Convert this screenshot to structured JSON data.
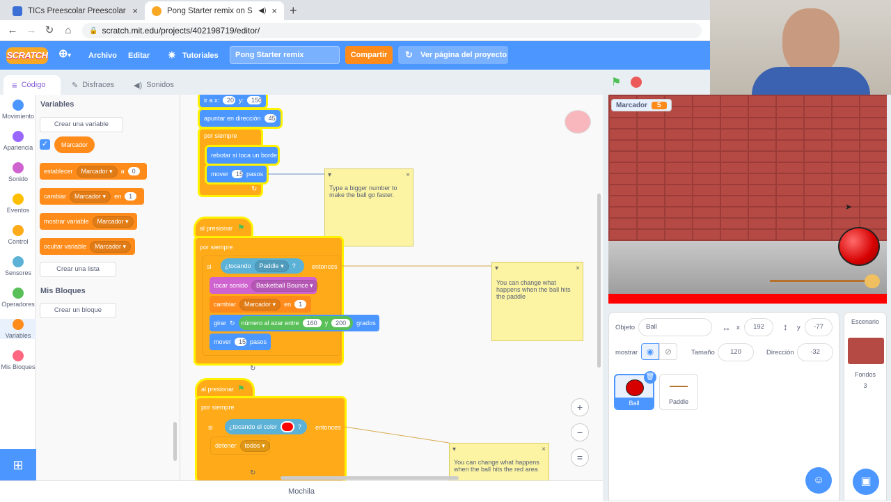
{
  "browser": {
    "tabs": [
      {
        "title": "TICs Preescolar Preescolar (V)",
        "close": "×"
      },
      {
        "title": "Pong Starter remix on Scratch",
        "close": "×"
      }
    ],
    "new_tab": "+",
    "url": "scratch.mit.edu/projects/402198719/editor/"
  },
  "menu": {
    "logo": "SCRATCH",
    "file": "Archivo",
    "edit": "Editar",
    "tutorials": "Tutoriales",
    "project_name": "Pong Starter remix",
    "share": "Compartir",
    "project_page": "Ver página del proyecto"
  },
  "editor_tabs": [
    "Código",
    "Disfraces",
    "Sonidos"
  ],
  "categories": [
    {
      "label": "Movimiento",
      "color": "#4c97ff"
    },
    {
      "label": "Apariencia",
      "color": "#9966ff"
    },
    {
      "label": "Sonido",
      "color": "#cf63cf"
    },
    {
      "label": "Eventos",
      "color": "#ffbf00"
    },
    {
      "label": "Control",
      "color": "#ffab19"
    },
    {
      "label": "Sensores",
      "color": "#5cb1d6"
    },
    {
      "label": "Operadores",
      "color": "#59c059"
    },
    {
      "label": "Variables",
      "color": "#ff8c1a"
    },
    {
      "label": "Mis Bloques",
      "color": "#ff6680"
    }
  ],
  "palette": {
    "variables_title": "Variables",
    "create_variable": "Crear una variable",
    "variable_name": "Marcador",
    "set_block": {
      "label": "establecer",
      "var": "Marcador",
      "to": "a",
      "value": "0"
    },
    "change_block": {
      "label": "cambiar",
      "var": "Marcador",
      "by": "en",
      "value": "1"
    },
    "show_block": {
      "label": "mostrar variable",
      "var": "Marcador"
    },
    "hide_block": {
      "label": "ocultar variable",
      "var": "Marcador"
    },
    "create_list": "Crear una lista",
    "my_blocks_title": "Mis Bloques",
    "create_block": "Crear un bloque"
  },
  "script1": {
    "goto": {
      "label": "ir a x:",
      "x": "20",
      "ylabel": "y:",
      "y": "150"
    },
    "point": {
      "label": "apuntar en dirección",
      "value": "45"
    },
    "forever": "por siempre",
    "bounce": "rebotar si toca un borde",
    "move": {
      "label": "mover",
      "value": "15",
      "unit": "pasos"
    },
    "loop_arrow": "↻"
  },
  "script2": {
    "hat": "al presionar",
    "forever": "por siempre",
    "if": "si",
    "touching": "¿tocando",
    "sprite": "Paddle",
    "q": "?",
    "then": "entonces",
    "play": "tocar sonido",
    "sound": "Basketball Bounce",
    "change": "cambiar",
    "var": "Marcador",
    "by": "en",
    "by_value": "1",
    "turn": "girar",
    "random": "número al azar entre",
    "r1": "160",
    "and": "y",
    "r2": "200",
    "degrees": "grados",
    "move": "mover",
    "move_value": "15",
    "steps": "pasos",
    "loop_arrow": "↻"
  },
  "script3": {
    "hat": "al presionar",
    "forever": "por siempre",
    "if": "si",
    "touching_color": "¿tocando el color",
    "q": "?",
    "then": "entonces",
    "stop": "detener",
    "stop_opt": "todos",
    "loop_arrow": "↻"
  },
  "notes": [
    "Type a bigger number to make the ball go faster.",
    "You can change what happens when the ball hits the paddle",
    "You can change what happens when the ball hits the red area"
  ],
  "backpack": "Mochila",
  "stage": {
    "monitor_label": "Marcador",
    "monitor_value": "5"
  },
  "sprite_info": {
    "sprite_label": "Objeto",
    "sprite_name": "Ball",
    "x_label": "x",
    "x": "192",
    "y_label": "y",
    "y": "-77",
    "show_label": "mostrar",
    "size_label": "Tamaño",
    "size": "120",
    "direction_label": "Dirección",
    "direction": "-32"
  },
  "sprites": [
    "Ball",
    "Paddle"
  ],
  "stage_pane": {
    "title": "Escenario",
    "backdrops_label": "Fondos",
    "backdrops": "3"
  },
  "colors": {
    "scratch_blue": "#4c97ff",
    "variables": "#ff8c1a",
    "control": "#ffab19",
    "glow": "#fff200",
    "danger": "#ff0000"
  }
}
